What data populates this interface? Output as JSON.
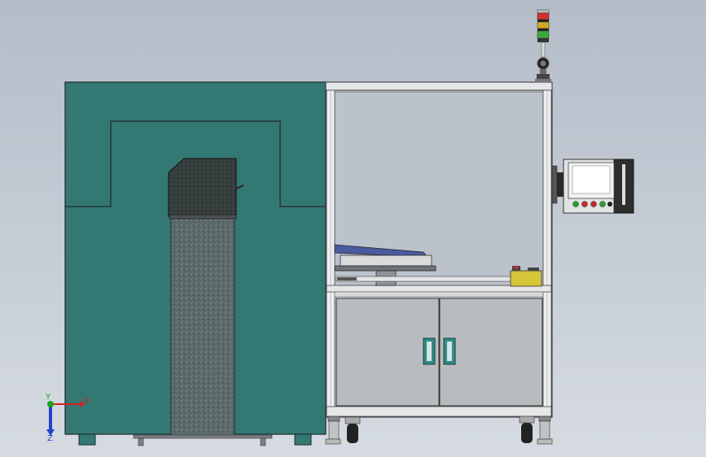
{
  "triad": {
    "x_label": "X",
    "y_label": "Y",
    "z_label": "Z",
    "x_color": "#d42020",
    "y_color": "#1ea01e",
    "z_color": "#2040c8"
  },
  "colors": {
    "enclosure": "#347874",
    "granite_dark": "#3a4242",
    "granite_column": "#5f6c6c",
    "frame_aluminum": "#e6e8ea",
    "cabinet_panel": "#b9bcbe",
    "handle": "#2f8c86",
    "yellow_box": "#d6c63a",
    "rail_blue": "#4a5aa0"
  },
  "signal_tower": {
    "lights": [
      "red",
      "yellow",
      "green"
    ]
  },
  "control_panel": {
    "buttons": [
      "green",
      "red",
      "red",
      "green",
      "black"
    ]
  }
}
